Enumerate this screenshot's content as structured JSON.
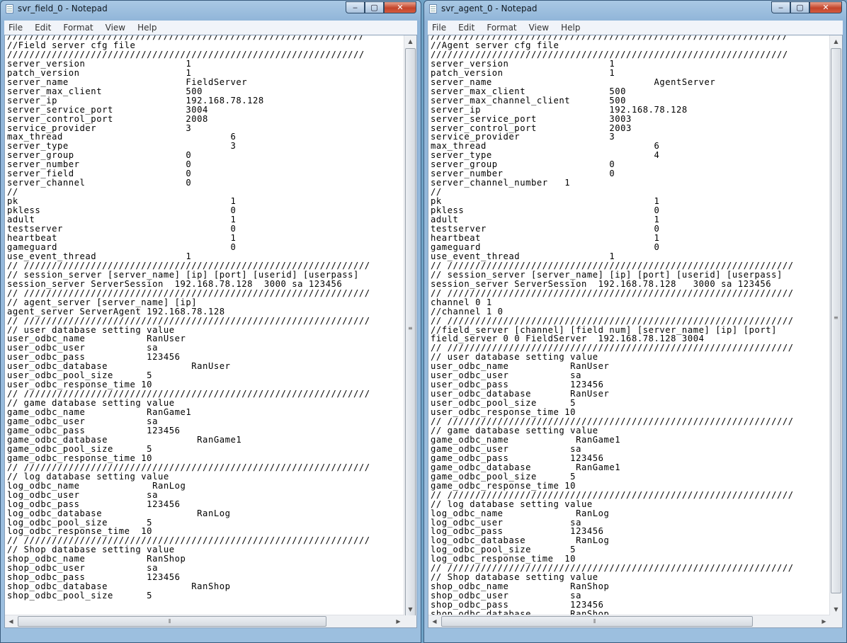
{
  "windows": [
    {
      "title": "svr_field_0 - Notepad",
      "controls": {
        "minimize": "‒",
        "maximize": "▢",
        "close": "✕"
      },
      "menu": [
        "File",
        "Edit",
        "Format",
        "View",
        "Help"
      ],
      "content": "////////////////////////////////////////////////////////////////\n//Field server cfg file\n////////////////////////////////////////////////////////////////\nserver_version                  1\npatch_version                   1\nserver_name                     FieldServer\nserver_max_client               500\nserver_ip                       192.168.78.128\nserver_service_port             3004\nserver_control_port             2008\nservice_provider                3\nmax_thread                              6\nserver_type                             3\nserver_group                    0\nserver_number                   0\nserver_field                    0\nserver_channel                  0\n//\npk                                      1\npkless                                  0\nadult                                   1\ntestserver                              0\nheartbeat                               1\ngameguard                               0\nuse_event_thread                1\n// //////////////////////////////////////////////////////////////\n// session_server [server_name] [ip] [port] [userid] [userpass]\nsession_server ServerSession  192.168.78.128  3000 sa 123456\n// //////////////////////////////////////////////////////////////\n// agent_server [server_name] [ip]\nagent_server ServerAgent 192.168.78.128\n// //////////////////////////////////////////////////////////////\n// user database setting value\nuser_odbc_name           RanUser\nuser_odbc_user           sa\nuser_odbc_pass           123456\nuser_odbc_database               RanUser\nuser_odbc_pool_size      5\nuser_odbc_response_time 10\n// //////////////////////////////////////////////////////////////\n// game database setting value\ngame_odbc_name           RanGame1\ngame_odbc_user           sa\ngame_odbc_pass           123456\ngame_odbc_database                RanGame1\ngame_odbc_pool_size      5\ngame_odbc_response_time 10\n// //////////////////////////////////////////////////////////////\n// log database setting value\nlog_odbc_name             RanLog\nlog_odbc_user            sa\nlog_odbc_pass            123456\nlog_odbc_database                 RanLog\nlog_odbc_pool_size       5\nlog_odbc_response_time  10\n// //////////////////////////////////////////////////////////////\n// Shop database setting value\nshop_odbc_name           RanShop\nshop_odbc_user           sa\nshop_odbc_pass           123456\nshop_odbc_database               RanShop\nshop_odbc_pool_size      5"
    },
    {
      "title": "svr_agent_0 - Notepad",
      "controls": {
        "minimize": "‒",
        "maximize": "▢",
        "close": "✕"
      },
      "menu": [
        "File",
        "Edit",
        "Format",
        "View",
        "Help"
      ],
      "content": "////////////////////////////////////////////////////////////////\n//Agent server cfg file\n////////////////////////////////////////////////////////////////\nserver_version                  1\npatch_version                   1\nserver_name                             AgentServer\nserver_max_client               500\nserver_max_channel_client       500\nserver_ip                       192.168.78.128\nserver_service_port             3003\nserver_control_port             2003\nservice_provider                3\nmax_thread                              6\nserver_type                             4\nserver_group                    0\nserver_number                   0\nserver_channel_number   1\n//\npk                                      1\npkless                                  0\nadult                                   1\ntestserver                              0\nheartbeat                               1\ngameguard                               0\nuse_event_thread                1\n// //////////////////////////////////////////////////////////////\n// session_server [server_name] [ip] [port] [userid] [userpass]\nsession_server ServerSession  192.168.78.128   3000 sa 123456\n// //////////////////////////////////////////////////////////////\nchannel 0 1\n//channel 1 0\n// //////////////////////////////////////////////////////////////\n//field_server [channel] [field num] [server_name] [ip] [port]\nfield_server 0 0 FieldServer  192.168.78.128 3004\n// //////////////////////////////////////////////////////////////\n// user database setting value\nuser_odbc_name           RanUser\nuser_odbc_user           sa\nuser_odbc_pass           123456\nuser_odbc_database       RanUser\nuser_odbc_pool_size      5\nuser_odbc_response_time 10\n// //////////////////////////////////////////////////////////////\n// game database setting value\ngame_odbc_name            RanGame1\ngame_odbc_user           sa\ngame_odbc_pass           123456\ngame_odbc_database        RanGame1\ngame_odbc_pool_size      5\ngame_odbc_response_time 10\n// //////////////////////////////////////////////////////////////\n// log database setting value\nlog_odbc_name             RanLog\nlog_odbc_user            sa\nlog_odbc_pass            123456\nlog_odbc_database         RanLog\nlog_odbc_pool_size       5\nlog_odbc_response_time  10\n// //////////////////////////////////////////////////////////////\n// Shop database setting value\nshop_odbc_name           RanShop\nshop_odbc_user           sa\nshop_odbc_pass           123456\nshop_odbc_database       RanShop"
    }
  ]
}
